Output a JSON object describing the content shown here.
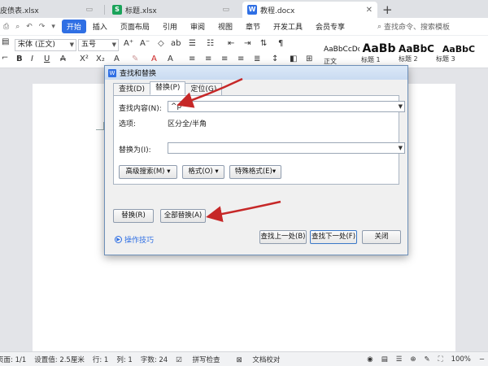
{
  "tabs": [
    {
      "label": "皮债表.xlsx",
      "type": "xlsx"
    },
    {
      "label": "标题.xlsx",
      "type": "xlsx"
    },
    {
      "label": "教程.docx",
      "type": "docx"
    }
  ],
  "menu": {
    "start": "开始",
    "items": [
      "插入",
      "页面布局",
      "引用",
      "审阅",
      "视图",
      "章节",
      "开发工具",
      "会员专享"
    ],
    "search_placeholder": "查找命令、搜索模板"
  },
  "ribbon": {
    "font_name": "宋体 (正文)",
    "font_size": "五号",
    "styles": [
      {
        "preview": "AaBbCcDd",
        "label": "正文"
      },
      {
        "preview": "AaBb",
        "label": "标题 1"
      },
      {
        "preview": "AaBbC",
        "label": "标题 2"
      },
      {
        "preview": "AaBbC",
        "label": "标题 3"
      }
    ]
  },
  "dialog": {
    "title": "查找和替换",
    "tabs": [
      "查找(D)",
      "替换(P)",
      "定位(G)"
    ],
    "find_label": "查找内容(N):",
    "find_value": "^p",
    "options_label": "选项:",
    "options_value": "区分全/半角",
    "replace_label": "替换为(I):",
    "replace_value": "",
    "advanced_btn": "高级搜索(M)",
    "format_btn": "格式(O)",
    "special_btn": "特殊格式(E)",
    "replace_btn": "替换(R)",
    "replace_all_btn": "全部替换(A)",
    "tips_label": "操作技巧",
    "find_prev_btn": "查找上一处(B)",
    "find_next_btn": "查找下一处(F)",
    "close_btn": "关闭"
  },
  "status": {
    "page": "页面: 1/1",
    "setting": "设置值: 2.5厘米",
    "row": "行: 1",
    "col": "列: 1",
    "words": "字数: 24",
    "spell": "拼写检查",
    "proof": "文档校对",
    "zoom": "100%"
  }
}
